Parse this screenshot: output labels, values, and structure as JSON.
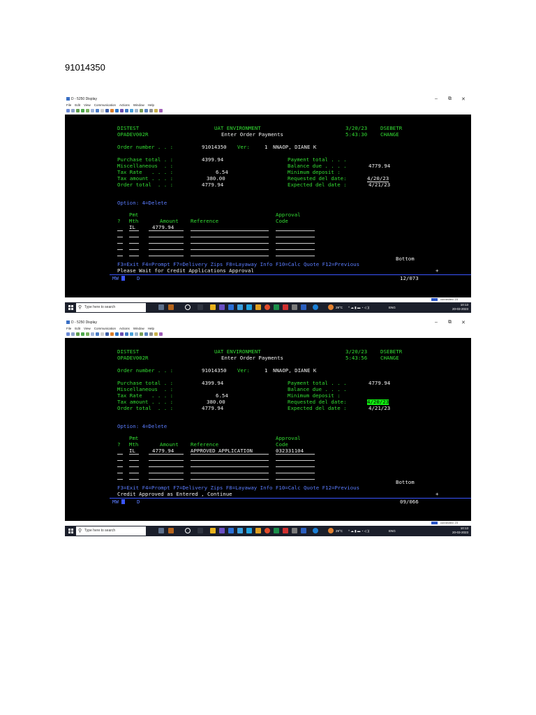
{
  "document": {
    "heading": "91014350"
  },
  "window": {
    "title": "D - 5250 Display",
    "menu": [
      "File",
      "Edit",
      "View",
      "Communication",
      "Actions",
      "Window",
      "Help"
    ],
    "controls": {
      "minimize": "–",
      "restore": "⧉",
      "close": "✕"
    }
  },
  "screenshots": [
    {
      "header": {
        "system": "DISTEST",
        "program": "OPADEV002R",
        "env": "UAT ENVIRONMENT",
        "screen_title": "Enter Order Payments",
        "date": "3/20/23",
        "user": "DSEBETR",
        "time": "5:43:30",
        "mode": "CHANGE"
      },
      "order": {
        "number_label": "Order number . . :",
        "number": "91014350",
        "ver_label": "Ver:",
        "ver": "1",
        "customer": "NNAOP, DIANE K"
      },
      "totals": {
        "purchase_label": "Purchase total . :",
        "purchase": "4399.94",
        "misc_label": "Miscellaneous  . :",
        "misc": "",
        "taxrate_label": "Tax Rate   . . . :",
        "taxrate": "6.54",
        "taxamt_label": "Tax amount . . . :",
        "taxamt": "380.00",
        "ordertotal_label": "Order total  . . :",
        "ordertotal": "4779.94"
      },
      "payment": {
        "paytotal_label": "Payment total . . .",
        "paytotal": "",
        "balance_label": "Balance due . . . .",
        "balance": "4779.94",
        "mindep_label": "Minimum deposit :",
        "mindep": "",
        "reqdel_label": "Requested del date:",
        "reqdel": "4/20/23",
        "expdel_label": "Expected del date :",
        "expdel": "4/21/23",
        "reqdel_highlight": false
      },
      "option_line": "Option: 4=Delete",
      "grid": {
        "h_pmt": "Pmt",
        "h_approval": "Approval",
        "h_q": "?",
        "h_mth": "Mth",
        "h_amount": "Amount",
        "h_reference": "Reference",
        "h_code": "Code",
        "row1": {
          "mth": "IL",
          "amount": "4779.94",
          "reference": "",
          "code": ""
        }
      },
      "bottom_label": "Bottom",
      "fkeys": "F3=Exit F4=Prompt F7=Delivery Zips F8=Layaway Info F10=Calc Quote F12=Previous",
      "message": "Please Wait for Credit Applications Approval",
      "plus": "+",
      "oia": {
        "left": "MW",
        "right": "12/073",
        "flag": "D"
      },
      "taskbar_time": "10:13",
      "taskbar_date": "20-03-2023"
    },
    {
      "header": {
        "system": "DISTEST",
        "program": "OPADEV002R",
        "env": "UAT ENVIRONMENT",
        "screen_title": "Enter Order Payments",
        "date": "3/20/23",
        "user": "DSEBETR",
        "time": "5:43:56",
        "mode": "CHANGE"
      },
      "order": {
        "number_label": "Order number . . :",
        "number": "91014350",
        "ver_label": "Ver:",
        "ver": "1",
        "customer": "NNAOP, DIANE K"
      },
      "totals": {
        "purchase_label": "Purchase total . :",
        "purchase": "4399.94",
        "misc_label": "Miscellaneous  . :",
        "misc": "",
        "taxrate_label": "Tax Rate   . . . :",
        "taxrate": "6.54",
        "taxamt_label": "Tax amount . . . :",
        "taxamt": "380.00",
        "ordertotal_label": "Order total  . . :",
        "ordertotal": "4779.94"
      },
      "payment": {
        "paytotal_label": "Payment total . . .",
        "paytotal": "4779.94",
        "balance_label": "Balance due . . . .",
        "balance": "",
        "mindep_label": "Minimum deposit :",
        "mindep": "",
        "reqdel_label": "Requested del date:",
        "reqdel": "4/20/23",
        "expdel_label": "Expected del date :",
        "expdel": "4/21/23",
        "reqdel_highlight": true
      },
      "option_line": "Option: 4=Delete",
      "grid": {
        "h_pmt": "Pmt",
        "h_approval": "Approval",
        "h_q": "?",
        "h_mth": "Mth",
        "h_amount": "Amount",
        "h_reference": "Reference",
        "h_code": "Code",
        "row1": {
          "mth": "IL",
          "amount": "4779.94",
          "reference": "APPROVED APPLICATION",
          "code": "032331104"
        }
      },
      "bottom_label": "Bottom",
      "fkeys": "F3=Exit F4=Prompt F7=Delivery Zips F8=Layaway Info F10=Calc Quote F12=Previous",
      "message": "Credit Approved as Entered , Continue",
      "plus": "+",
      "oia": {
        "left": "MW",
        "right": "09/066",
        "flag": "D"
      },
      "taskbar_time": "10:13",
      "taskbar_date": "20-03-2023"
    }
  ],
  "taskbar": {
    "search_placeholder": "Type here to search",
    "weather": "29°C",
    "lang": "ENG",
    "oia_conn": "connected: 23"
  }
}
